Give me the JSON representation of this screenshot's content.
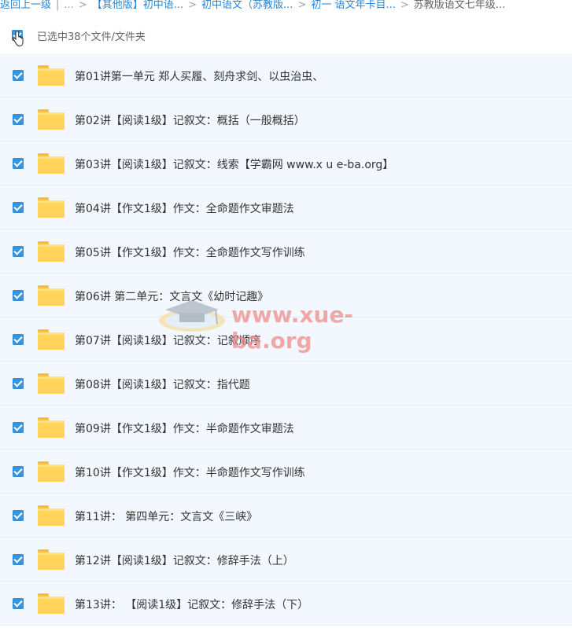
{
  "breadcrumb": {
    "back_label": "返回上一级",
    "ellipsis": "...",
    "items": [
      "【其他版】初中语...",
      "初中语文（苏教版...",
      "初一 语文年卡目...",
      "苏教版语文七年级..."
    ]
  },
  "selection": {
    "status": "已选中38个文件/文件夹"
  },
  "files": [
    {
      "name": "第01讲第一单元 郑人买履、刻舟求剑、以虫治虫、"
    },
    {
      "name": "第02讲【阅读1级】记叙文：概括（一般概括）"
    },
    {
      "name": "第03讲【阅读1级】记叙文：线索【学霸网 www.x u e-ba.org】"
    },
    {
      "name": "第04讲【作文1级】作文：全命题作文审题法"
    },
    {
      "name": "第05讲【作文1级】作文：全命题作文写作训练"
    },
    {
      "name": "第06讲 第二单元：文言文《幼时记趣》"
    },
    {
      "name": "第07讲【阅读1级】记叙文：记叙顺序"
    },
    {
      "name": "第08讲【阅读1级】记叙文：指代题"
    },
    {
      "name": "第09讲【作文1级】作文：半命题作文审题法"
    },
    {
      "name": "第10讲【作文1级】作文：半命题作文写作训练"
    },
    {
      "name": "第11讲： 第四单元：文言文《三峡》"
    },
    {
      "name": "第12讲【阅读1级】记叙文：修辞手法（上）"
    },
    {
      "name": "第13讲： 【阅读1级】记叙文：修辞手法（下）"
    }
  ],
  "watermark": {
    "text": "www.xue-ba.org"
  },
  "colors": {
    "accent": "#2a86d4",
    "checkbox": "#3a95e0",
    "row_bg": "#f2f8fe",
    "folder": "#ffd45a"
  }
}
